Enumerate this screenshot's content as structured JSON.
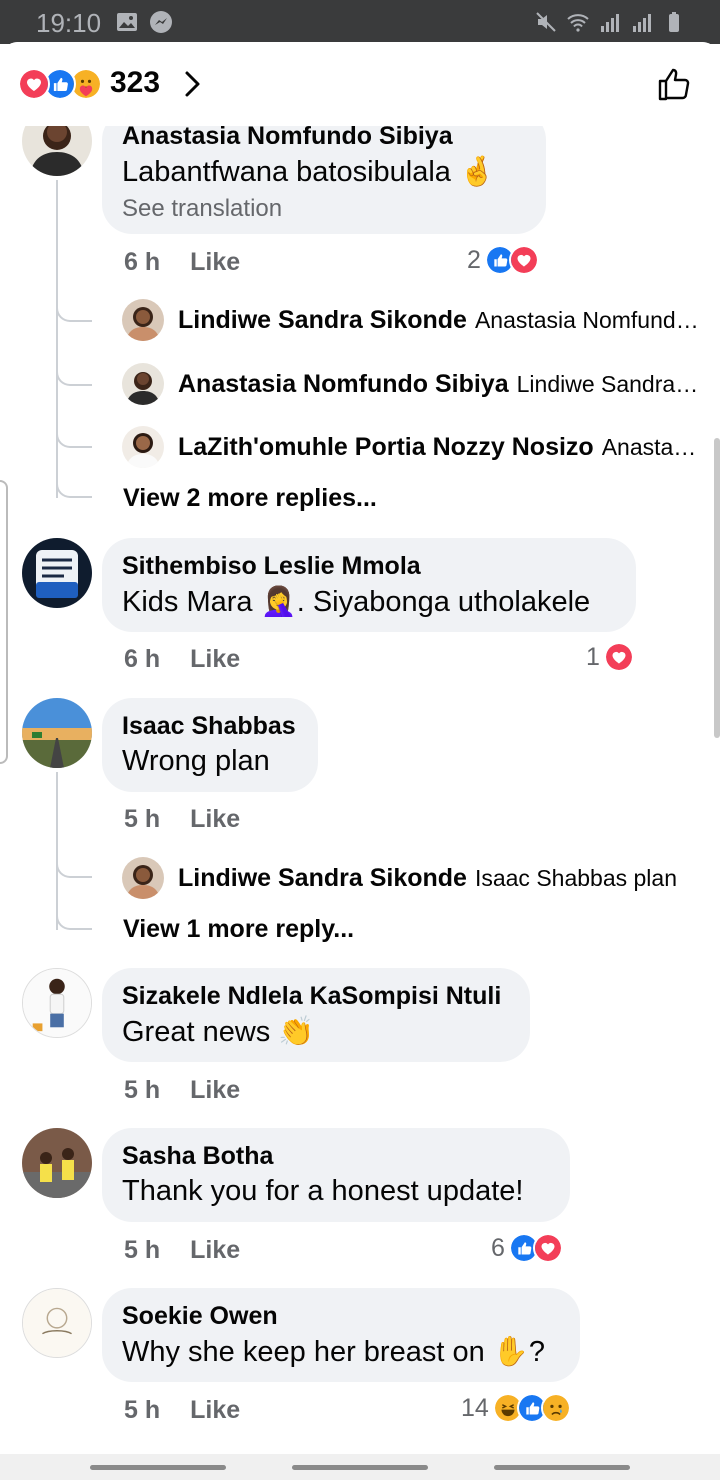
{
  "status_bar": {
    "time": "19:10",
    "left_icons": [
      "image-icon",
      "messenger-icon"
    ],
    "right_icons": [
      "mute-icon",
      "wifi-icon",
      "signal-icon",
      "signal-icon",
      "battery-icon"
    ]
  },
  "header": {
    "reaction_count": "323",
    "reactions": [
      "love",
      "like",
      "care"
    ]
  },
  "colors": {
    "like": "#1877f2",
    "love": "#f33e58",
    "bubble": "#f0f2f5",
    "meta": "#65676b",
    "status_bar": "#3a3b3c"
  },
  "comments": [
    {
      "name": "Anastasia Nomfundo Sibiya",
      "text": "Labantfwana batosibulala 🤞",
      "translate": "See translation",
      "time": "6 h",
      "like": "Like",
      "reaction_count": "2",
      "reactions": [
        "like",
        "love"
      ],
      "replies": [
        {
          "name": "Lindiwe Sandra Sikonde",
          "text": "Anastasia Nomfundo Sibiya"
        },
        {
          "name": "Anastasia Nomfundo Sibiya",
          "text": "Lindiwe Sandra Sikonde"
        },
        {
          "name": "LaZith'omuhle Portia Nozzy Nosizo",
          "text": "Anastasia Nomfundo Sibiya"
        }
      ],
      "view_more": "View 2 more replies..."
    },
    {
      "name": "Sithembiso Leslie Mmola",
      "text": "Kids Mara 🤦‍♀️. Siyabonga utholakele",
      "time": "6 h",
      "like": "Like",
      "reaction_count": "1",
      "reactions": [
        "love"
      ]
    },
    {
      "name": "Isaac Shabbas",
      "text": "Wrong plan",
      "time": "5 h",
      "like": "Like",
      "replies": [
        {
          "name": "Lindiwe Sandra Sikonde",
          "text": "Isaac Shabbas plan"
        }
      ],
      "view_more": "View 1 more reply..."
    },
    {
      "name": "Sizakele Ndlela KaSompisi Ntuli",
      "text": "Great news 👏",
      "time": "5 h",
      "like": "Like"
    },
    {
      "name": "Sasha Botha",
      "text": "Thank you for a honest update!",
      "time": "5 h",
      "like": "Like",
      "reaction_count": "6",
      "reactions": [
        "like",
        "love"
      ]
    },
    {
      "name": "Soekie Owen",
      "text": "Why she keep her breast on ✋?",
      "time": "5 h",
      "like": "Like",
      "reaction_count": "14",
      "reactions": [
        "haha",
        "like",
        "sad"
      ]
    }
  ]
}
